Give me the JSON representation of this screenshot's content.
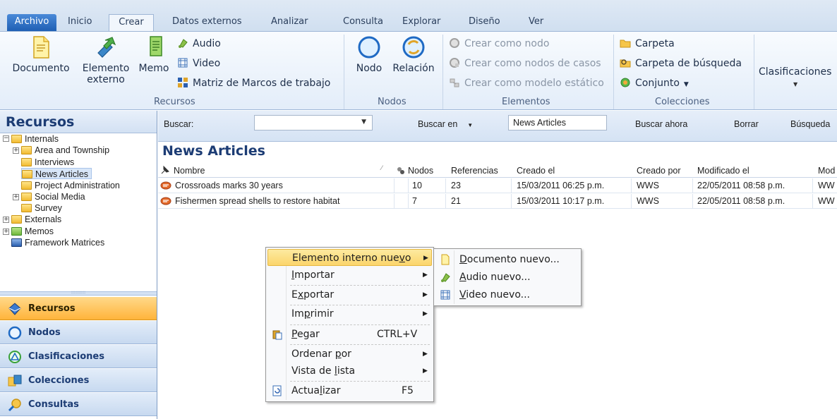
{
  "tabs": [
    "Archivo",
    "Inicio",
    "Crear",
    "Datos externos",
    "Analizar",
    "Consulta",
    "Explorar",
    "Diseño",
    "Ver"
  ],
  "ribbon": {
    "recursos": {
      "documento": "Documento",
      "elemento_externo_1": "Elemento",
      "elemento_externo_2": "externo",
      "memo": "Memo",
      "audio": "Audio",
      "video": "Video",
      "matriz": "Matriz de Marcos de trabajo",
      "label": "Recursos"
    },
    "nodos": {
      "nodo": "Nodo",
      "relacion": "Relación",
      "label": "Nodos"
    },
    "elementos": {
      "como_nodo": "Crear como nodo",
      "como_casos": "Crear como nodos de casos",
      "como_estatico": "Crear como modelo estático",
      "label": "Elementos"
    },
    "colecciones": {
      "carpeta": "Carpeta",
      "carpeta_busqueda": "Carpeta de búsqueda",
      "conjunto": "Conjunto",
      "label": "Colecciones"
    },
    "clasificaciones": "Clasificaciones"
  },
  "leftpane": {
    "title": "Recursos",
    "tree": {
      "internals": "Internals",
      "area": "Area and Township",
      "interviews": "Interviews",
      "news": "News Articles",
      "project": "Project Administration",
      "social": "Social Media",
      "survey": "Survey",
      "externals": "Externals",
      "memos": "Memos",
      "framework": "Framework Matrices"
    },
    "nav": [
      "Recursos",
      "Nodos",
      "Clasificaciones",
      "Colecciones",
      "Consultas"
    ]
  },
  "search": {
    "buscar": "Buscar:",
    "buscar_en": "Buscar en",
    "field": "News Articles",
    "buscar_ahora": "Buscar ahora",
    "borrar": "Borrar",
    "busqueda": "Búsqueda"
  },
  "list": {
    "title": "News Articles",
    "columns": [
      "Nombre",
      "Nodos",
      "Referencias",
      "Creado el",
      "Creado por",
      "Modificado el",
      "Mod"
    ],
    "rows": [
      {
        "nombre": "Crossroads marks 30 years",
        "nodos": "10",
        "refs": "23",
        "creado": "15/03/2011 06:25 p.m.",
        "por": "WWS",
        "modificado": "22/05/2011 08:58 p.m.",
        "mod": "WW"
      },
      {
        "nombre": "Fishermen spread shells to restore habitat",
        "nodos": "7",
        "refs": "21",
        "creado": "15/03/2011 10:17 p.m.",
        "por": "WWS",
        "modificado": "22/05/2011 08:58 p.m.",
        "mod": "WW"
      }
    ]
  },
  "context_menu": {
    "nuevo_a": "Elemento interno nue",
    "nuevo_u": "v",
    "nuevo_b": "o",
    "importar_u": "I",
    "importar_b": "mportar",
    "exportar_a": "E",
    "exportar_u": "x",
    "exportar_b": "portar",
    "imprimir_a": "Im",
    "imprimir_u": "p",
    "imprimir_b": "rimir",
    "pegar_u": "P",
    "pegar_b": "egar",
    "pegar_sc": "CTRL+V",
    "ordenar_a": "Ordenar ",
    "ordenar_u": "p",
    "ordenar_b": "or",
    "vista_a": "Vista de ",
    "vista_u": "l",
    "vista_b": "ista",
    "actualizar_a": "Actua",
    "actualizar_u": "l",
    "actualizar_b": "izar",
    "actualizar_sc": "F5"
  },
  "submenu": {
    "documento_u": "D",
    "documento_b": "ocumento nuevo...",
    "audio_u": "A",
    "audio_b": "udio nuevo...",
    "video_u": "V",
    "video_b": "ideo nuevo..."
  },
  "colors": {
    "accent": "#1c3c74",
    "highlight": "#fbd56b",
    "active_nav": "#ffb43b"
  }
}
